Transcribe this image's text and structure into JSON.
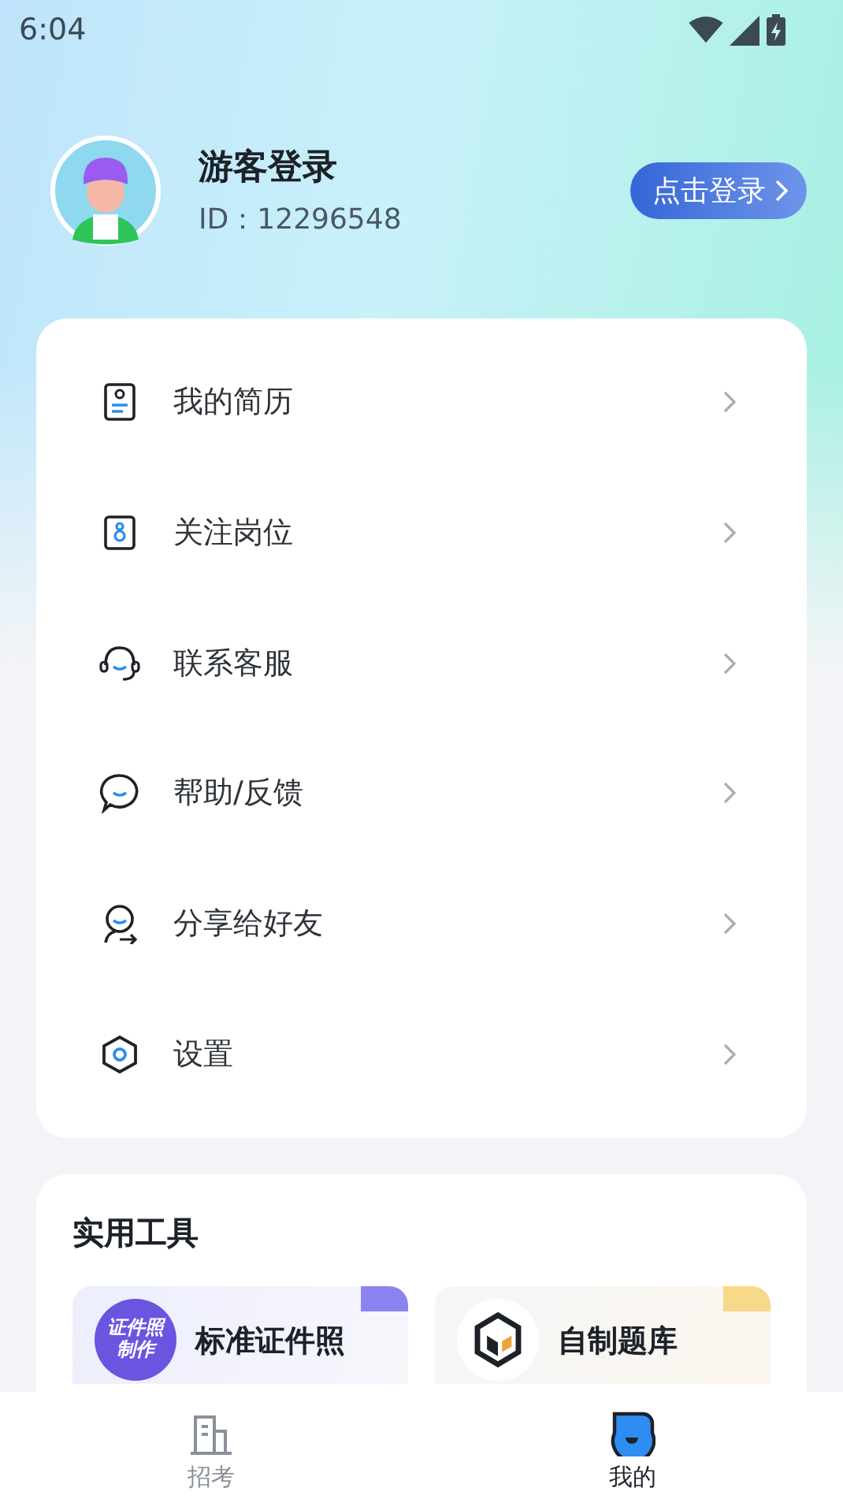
{
  "status_bar": {
    "time": "6:04"
  },
  "profile": {
    "name": "游客登录",
    "id_label": "ID：",
    "id_value": "12296548",
    "login_button": "点击登录"
  },
  "menu": [
    {
      "kind": "resume",
      "label": "我的简历"
    },
    {
      "kind": "follow",
      "label": "关注岗位"
    },
    {
      "kind": "service",
      "label": "联系客服"
    },
    {
      "kind": "help",
      "label": "帮助/反馈"
    },
    {
      "kind": "share",
      "label": "分享给好友"
    },
    {
      "kind": "settings",
      "label": "设置"
    }
  ],
  "tools": {
    "title": "实用工具",
    "items": [
      {
        "kind": "photo",
        "title": "标准证件照",
        "badge_lines": [
          "证件照",
          "制作"
        ],
        "color": "#8b84f0"
      },
      {
        "kind": "quiz",
        "title": "自制题库",
        "color": "#f8d98a"
      }
    ]
  },
  "tab_bar": [
    {
      "kind": "exam",
      "label": "招考",
      "selected": false
    },
    {
      "kind": "mine",
      "label": "我的",
      "selected": true
    }
  ]
}
